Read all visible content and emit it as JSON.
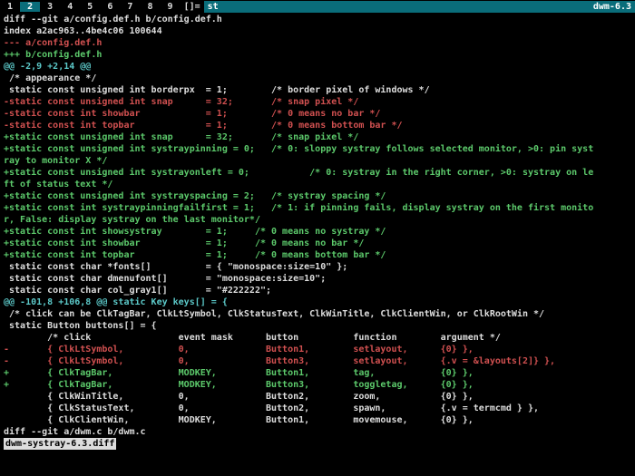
{
  "topbar": {
    "tags": [
      "1",
      "2",
      "3",
      "4",
      "5",
      "6",
      "7",
      "8",
      "9"
    ],
    "selected_tag_index": 1,
    "layout_symbol": "[]=",
    "window_title": "st",
    "status_right": "dwm-6.3"
  },
  "diff": {
    "lines": [
      {
        "cls": "c-diff",
        "text": "diff --git a/config.def.h b/config.def.h"
      },
      {
        "cls": "c-idx",
        "text": "index a2ac963..4be4c06 100644"
      },
      {
        "cls": "c-minushdr",
        "text": "--- a/config.def.h"
      },
      {
        "cls": "c-plushdr",
        "text": "+++ b/config.def.h"
      },
      {
        "cls": "c-hunk",
        "text": "@@ -2,9 +2,14 @@"
      },
      {
        "cls": "c-ctx",
        "text": ""
      },
      {
        "cls": "c-ctx",
        "text": " /* appearance */"
      },
      {
        "cls": "c-ctx",
        "text": " static const unsigned int borderpx  = 1;        /* border pixel of windows */"
      },
      {
        "cls": "c-del",
        "text": "-static const unsigned int snap      = 32;       /* snap pixel */"
      },
      {
        "cls": "c-del",
        "text": "-static const int showbar            = 1;        /* 0 means no bar */"
      },
      {
        "cls": "c-del",
        "text": "-static const int topbar             = 1;        /* 0 means bottom bar */"
      },
      {
        "cls": "c-add",
        "text": "+static const unsigned int snap      = 32;       /* snap pixel */"
      },
      {
        "cls": "c-add",
        "text": "+static const unsigned int systraypinning = 0;   /* 0: sloppy systray follows selected monitor, >0: pin systray to monitor X */"
      },
      {
        "cls": "c-add",
        "text": "+static const unsigned int systrayonleft = 0;           /* 0: systray in the right corner, >0: systray on left of status text */"
      },
      {
        "cls": "c-add",
        "text": "+static const unsigned int systrayspacing = 2;   /* systray spacing */"
      },
      {
        "cls": "c-add",
        "text": "+static const int systraypinningfailfirst = 1;   /* 1: if pinning fails, display systray on the first monitor, False: display systray on the last monitor*/"
      },
      {
        "cls": "c-add",
        "text": "+static const int showsystray        = 1;     /* 0 means no systray */"
      },
      {
        "cls": "c-add",
        "text": "+static const int showbar            = 1;     /* 0 means no bar */"
      },
      {
        "cls": "c-add",
        "text": "+static const int topbar             = 1;     /* 0 means bottom bar */"
      },
      {
        "cls": "c-ctx",
        "text": " static const char *fonts[]          = { \"monospace:size=10\" };"
      },
      {
        "cls": "c-ctx",
        "text": " static const char dmenufont[]       = \"monospace:size=10\";"
      },
      {
        "cls": "c-ctx",
        "text": " static const char col_gray1[]       = \"#222222\";"
      },
      {
        "cls": "c-hunk",
        "text": "@@ -101,8 +106,8 @@ static Key keys[] = {"
      },
      {
        "cls": "c-ctx",
        "text": " /* click can be ClkTagBar, ClkLtSymbol, ClkStatusText, ClkWinTitle, ClkClientWin, or ClkRootWin */"
      },
      {
        "cls": "c-ctx",
        "text": " static Button buttons[] = {"
      },
      {
        "cls": "c-ctx",
        "text": "        /* click                event mask      button          function        argument */"
      },
      {
        "cls": "c-del",
        "text": "-       { ClkLtSymbol,          0,              Button1,        setlayout,      {0} },"
      },
      {
        "cls": "c-del",
        "text": "-       { ClkLtSymbol,          0,              Button3,        setlayout,      {.v = &layouts[2]} },"
      },
      {
        "cls": "c-add",
        "text": "+       { ClkTagBar,            MODKEY,         Button1,        tag,            {0} },"
      },
      {
        "cls": "c-add",
        "text": "+       { ClkTagBar,            MODKEY,         Button3,        toggletag,      {0} },"
      },
      {
        "cls": "c-ctx",
        "text": "        { ClkWinTitle,          0,              Button2,        zoom,           {0} },"
      },
      {
        "cls": "c-ctx",
        "text": "        { ClkStatusText,        0,              Button2,        spawn,          {.v = termcmd } },"
      },
      {
        "cls": "c-ctx",
        "text": "        { ClkClientWin,         MODKEY,         Button1,        movemouse,      {0} },"
      },
      {
        "cls": "c-diff",
        "text": "diff --git a/dwm.c b/dwm.c"
      }
    ],
    "statusline": "dwm-systray-6.3.diff"
  },
  "wrap_width": 108
}
